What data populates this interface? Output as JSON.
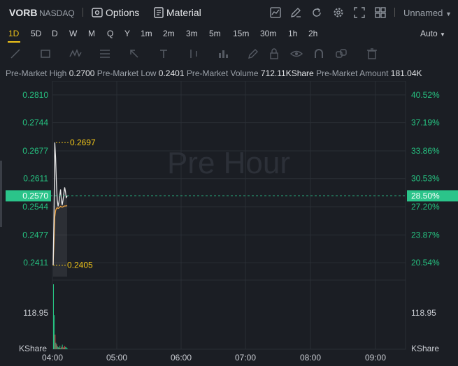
{
  "header": {
    "symbol": "VORB",
    "exchange": "NASDAQ",
    "options_label": "Options",
    "material_label": "Material",
    "layout_name": "Unnamed",
    "icons": [
      "chart-icon",
      "edit-icon",
      "refresh-icon",
      "settings-icon",
      "fullscreen-icon",
      "grid-icon"
    ]
  },
  "timeframes": [
    "1D",
    "5D",
    "D",
    "W",
    "M",
    "Q",
    "Y",
    "1m",
    "2m",
    "3m",
    "5m",
    "15m",
    "30m",
    "1h",
    "2h"
  ],
  "active_timeframe": "1D",
  "scale_mode": "Auto",
  "tools": [
    "line-tool-icon",
    "rect-tool-icon",
    "wave-tool-icon",
    "fib-tool-icon",
    "arrow-tool-icon",
    "text-tool-icon",
    "bar-tool-icon",
    "pencil-tool-icon",
    "lock-tool-icon",
    "eye-tool-icon",
    "magnet-tool-icon",
    "link-tool-icon",
    "delete-tool-icon"
  ],
  "info": [
    {
      "label": "Pre-Market High",
      "value": "0.2700"
    },
    {
      "label": "Pre-Market Low",
      "value": "0.2401"
    },
    {
      "label": "Pre-Market Volume",
      "value": "712.11KShare"
    },
    {
      "label": "Pre-Market Amount",
      "value": "181.04K"
    }
  ],
  "watermark": "Pre Hour",
  "colors": {
    "up": "#26c281",
    "down": "#e5484d",
    "accent": "#f0c419",
    "price_line": "#e8e8e8",
    "avg_line": "#f2a541",
    "current_bg": "#2bc48a"
  },
  "chart_data": {
    "type": "line",
    "title": "",
    "price_axis_left": [
      "0.2810",
      "0.2744",
      "0.2677",
      "0.2611",
      "0.2544",
      "0.2477",
      "0.2411"
    ],
    "percent_axis_right": [
      "40.52%",
      "37.19%",
      "33.86%",
      "30.53%",
      "27.20%",
      "23.87%",
      "20.54%"
    ],
    "current_price": "0.2570",
    "current_percent": "28.50%",
    "high_marker": "0.2697",
    "low_marker": "0.2405",
    "volume_tick": "118.95",
    "volume_unit": "KShare",
    "x_ticks": [
      "04:00",
      "05:00",
      "06:00",
      "07:00",
      "08:00",
      "09:00"
    ],
    "ylim": [
      0.2378,
      0.2843
    ],
    "series": [
      {
        "x": [
          0,
          1,
          2,
          3,
          4,
          5,
          6,
          7,
          8,
          9,
          10,
          11,
          12,
          13,
          14,
          15,
          16,
          17
        ],
        "values": [
          0.2405,
          0.252,
          0.2697,
          0.266,
          0.26,
          0.256,
          0.2545,
          0.2555,
          0.257,
          0.2585,
          0.256,
          0.2548,
          0.256,
          0.2575,
          0.259,
          0.258,
          0.2565,
          0.257
        ]
      },
      {
        "x": [
          0,
          1,
          2,
          3,
          4,
          5,
          6,
          7,
          8,
          9,
          10,
          11,
          12,
          13,
          14,
          15,
          16,
          17
        ],
        "values": [
          0.2405,
          0.246,
          0.252,
          0.2535,
          0.254,
          0.2542,
          0.254,
          0.2541,
          0.2543,
          0.2545,
          0.2544,
          0.2543,
          0.2544,
          0.2545,
          0.2546,
          0.2546,
          0.2546,
          0.2547
        ]
      }
    ],
    "volume": [
      {
        "v": 400,
        "c": "up"
      },
      {
        "v": 210,
        "c": "up"
      },
      {
        "v": 90,
        "c": "down"
      },
      {
        "v": 40,
        "c": "up"
      },
      {
        "v": 30,
        "c": "down"
      },
      {
        "v": 18,
        "c": "up"
      },
      {
        "v": 12,
        "c": "up"
      },
      {
        "v": 10,
        "c": "down"
      },
      {
        "v": 22,
        "c": "up"
      },
      {
        "v": 8,
        "c": "up"
      },
      {
        "v": 15,
        "c": "down"
      },
      {
        "v": 28,
        "c": "up"
      },
      {
        "v": 12,
        "c": "down"
      },
      {
        "v": 9,
        "c": "up"
      },
      {
        "v": 20,
        "c": "down"
      },
      {
        "v": 14,
        "c": "up"
      },
      {
        "v": 11,
        "c": "up"
      },
      {
        "v": 6,
        "c": "up"
      }
    ]
  }
}
